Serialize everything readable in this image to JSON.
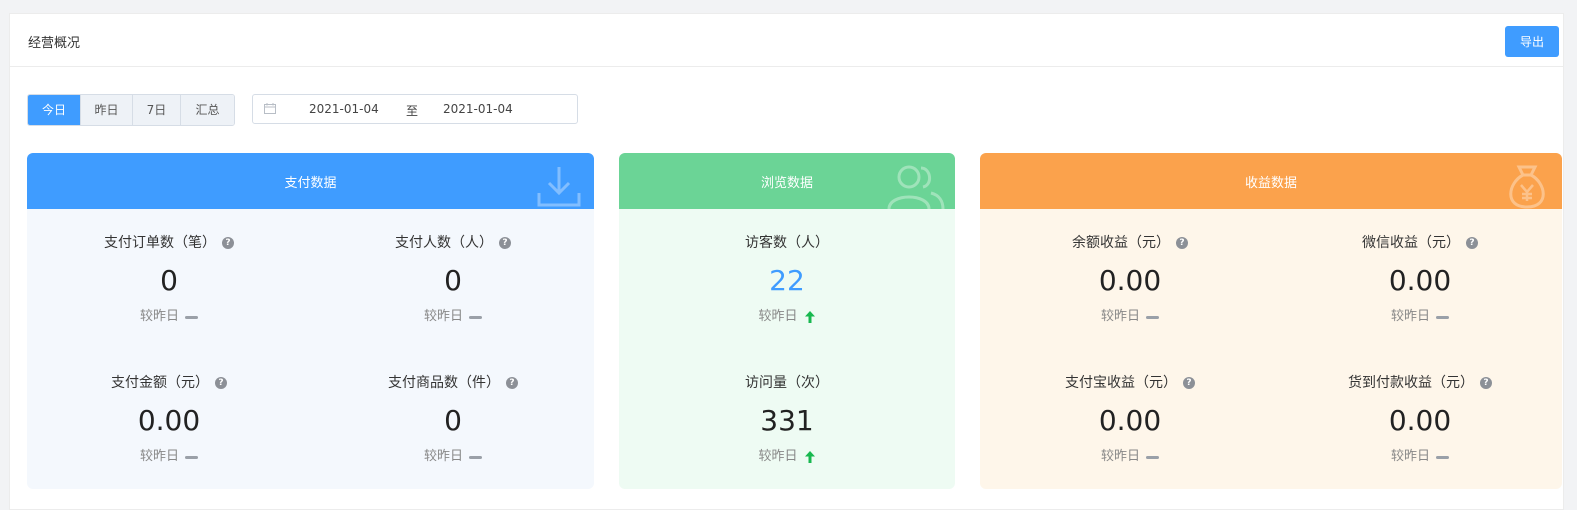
{
  "header": {
    "title": "经营概况",
    "export_label": "导出"
  },
  "tabs": [
    {
      "label": "今日",
      "active": true
    },
    {
      "label": "昨日",
      "active": false
    },
    {
      "label": "7日",
      "active": false
    },
    {
      "label": "汇总",
      "active": false
    }
  ],
  "date_range": {
    "start": "2021-01-04",
    "separator": "至",
    "end": "2021-01-04"
  },
  "payment": {
    "title": "支付数据",
    "color": "#3f9cff",
    "bg": "#f4f8fd",
    "metrics": [
      {
        "label": "支付订单数（笔）",
        "value": "0",
        "compare": "较昨日",
        "trend": "flat"
      },
      {
        "label": "支付人数（人）",
        "value": "0",
        "compare": "较昨日",
        "trend": "flat"
      },
      {
        "label": "支付金额（元）",
        "value": "0.00",
        "compare": "较昨日",
        "trend": "flat"
      },
      {
        "label": "支付商品数（件）",
        "value": "0",
        "compare": "较昨日",
        "trend": "flat"
      }
    ]
  },
  "browse": {
    "title": "浏览数据",
    "color": "#6bd496",
    "bg": "#eefbf3",
    "metrics": [
      {
        "label": "访客数（人）",
        "value": "22",
        "compare": "较昨日",
        "trend": "up"
      },
      {
        "label": "访问量（次）",
        "value": "331",
        "compare": "较昨日",
        "trend": "up"
      }
    ]
  },
  "income": {
    "title": "收益数据",
    "color": "#fba24c",
    "bg": "#fef6ea",
    "metrics": [
      {
        "label": "余额收益（元）",
        "value": "0.00",
        "compare": "较昨日",
        "trend": "flat"
      },
      {
        "label": "微信收益（元）",
        "value": "0.00",
        "compare": "较昨日",
        "trend": "flat"
      },
      {
        "label": "支付宝收益（元）",
        "value": "0.00",
        "compare": "较昨日",
        "trend": "flat"
      },
      {
        "label": "货到付款收益（元）",
        "value": "0.00",
        "compare": "较昨日",
        "trend": "flat"
      }
    ]
  },
  "help_glyph": "?",
  "icons": {
    "calendar": "calendar-icon",
    "help": "help-icon",
    "flat": "dash-icon",
    "up": "arrow-up-icon"
  }
}
